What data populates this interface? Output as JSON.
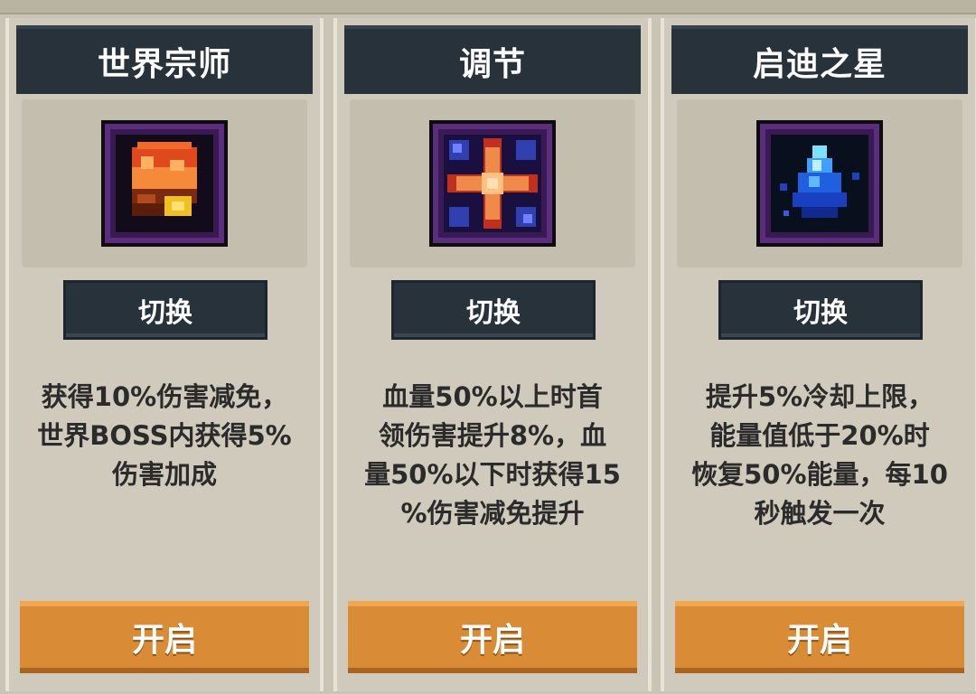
{
  "cards": [
    {
      "title": "世界宗师",
      "icon": "fire-chest-icon",
      "switch_label": "切换",
      "description": "获得10%伤害减免，\n世界BOSS内获得5%\n伤害加成",
      "open_label": "开启"
    },
    {
      "title": "调节",
      "icon": "cross-star-icon",
      "switch_label": "切换",
      "description": "血量50%以上时首\n领伤害提升8%，血\n量50%以下时获得15\n%伤害减免提升",
      "open_label": "开启"
    },
    {
      "title": "启迪之星",
      "icon": "blue-crystal-icon",
      "switch_label": "切换",
      "description": "提升5%冷却上限，\n能量值低于20%时\n恢复50%能量，每10\n秒触发一次",
      "open_label": "开启"
    }
  ],
  "colors": {
    "header_bg": "#27323b",
    "card_bg": "#cfcabb",
    "open_button": "#d98b36",
    "icon_frame": "#5a2d7e"
  }
}
